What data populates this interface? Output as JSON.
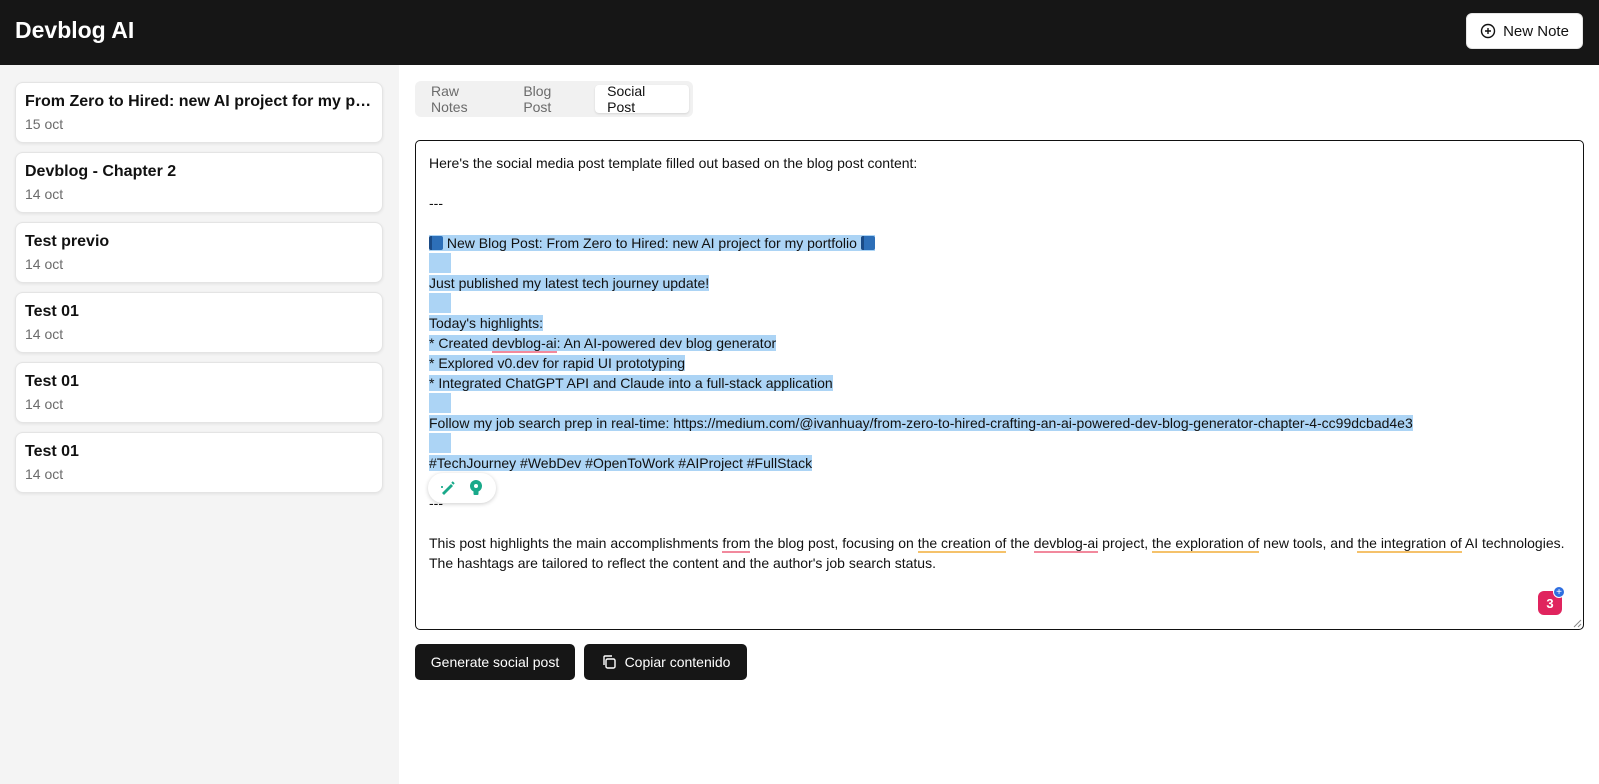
{
  "header": {
    "app_title": "Devblog AI",
    "new_note_label": "New Note"
  },
  "sidebar": {
    "notes": [
      {
        "title": "From Zero to Hired: new AI project for my portfolio",
        "date": "15 oct"
      },
      {
        "title": "Devblog - Chapter 2",
        "date": "14 oct"
      },
      {
        "title": "Test previo",
        "date": "14 oct"
      },
      {
        "title": "Test 01",
        "date": "14 oct"
      },
      {
        "title": "Test 01",
        "date": "14 oct"
      },
      {
        "title": "Test 01",
        "date": "14 oct"
      }
    ]
  },
  "tabs": [
    {
      "label": "Raw Notes",
      "active": false
    },
    {
      "label": "Blog Post",
      "active": false
    },
    {
      "label": "Social Post",
      "active": true
    }
  ],
  "editor": {
    "intro": "Here's the social media post template filled out based on the blog post content:",
    "sep1": "---",
    "headline": "New Blog Post: From Zero to Hired: new AI project for my portfolio",
    "published": "Just published my latest tech journey update!",
    "highlights_title": "Today's highlights:",
    "h1_pre": "* Created ",
    "h1_word": "devblog-ai",
    "h1_post": ": An AI-powered dev blog generator",
    "h2": "* Explored v0.dev for rapid UI prototyping",
    "h3": "* Integrated ChatGPT API and Claude into a full-stack application",
    "follow": "Follow my job search prep in real-time: https://medium.com/@ivanhuay/from-zero-to-hired-crafting-an-ai-powered-dev-blog-generator-chapter-4-cc99dcbad4e3",
    "hashtags": "#TechJourney #WebDev #OpenToWork #AIProject #FullStack",
    "sep2": "---",
    "c1": "This post highlights the main accomplishments ",
    "c2": "from",
    "c3": " the blog post, focusing on ",
    "c4": "the creation of",
    "c5": " the ",
    "c6": "devblog-ai",
    "c7": " project, ",
    "c8": "the exploration of",
    "c9": " new tools, and ",
    "c10": "the integration of",
    "c11": " AI technologies. The hashtags are tailored to reflect the content and the author's job search status.",
    "badge_count": "3"
  },
  "actions": {
    "generate_label": "Generate social post",
    "copy_label": "Copiar contenido"
  },
  "colors": {
    "topbar": "#161616",
    "selection": "#acd4f5",
    "spell_underline": "#f2899d",
    "grammar_underline": "#f5c26b"
  }
}
